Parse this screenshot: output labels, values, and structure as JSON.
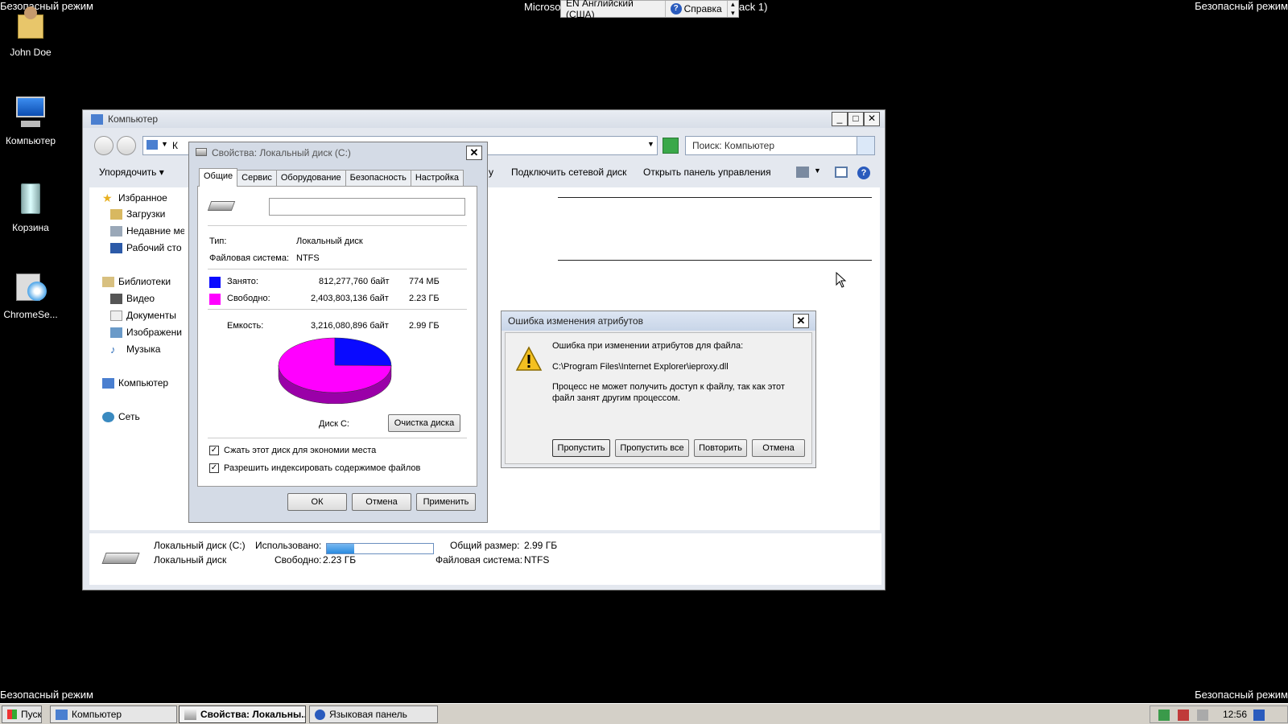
{
  "desktop": {
    "safe_mode": "Безопасный режим",
    "icons": [
      {
        "label": "John Doe",
        "icon": "user-folder-icon"
      },
      {
        "label": "Компьютер",
        "icon": "computer-icon"
      },
      {
        "label": "Корзина",
        "icon": "recycle-bin-icon"
      },
      {
        "label": "ChromeSe...",
        "icon": "setup-icon"
      }
    ],
    "top_title_left": "Microso",
    "top_title_right": "ack 1)"
  },
  "language_bar": {
    "language": "EN Английский (США)",
    "help": "Справка"
  },
  "explorer": {
    "title": "Компьютер",
    "address_fragment": "К",
    "search_placeholder": "Поиск: Компьютер",
    "toolbar": {
      "organize": "Упорядочить",
      "truncated": "у",
      "map_drive": "Подключить сетевой диск",
      "control_panel": "Открыть панель управления"
    },
    "nav": {
      "favorites": "Избранное",
      "downloads": "Загрузки",
      "recent": "Недавние ме",
      "desktop": "Рабочий сто",
      "libraries": "Библиотеки",
      "video": "Видео",
      "documents": "Документы",
      "pictures": "Изображени",
      "music": "Музыка",
      "computer": "Компьютер",
      "network": "Сеть"
    },
    "details": {
      "name": "Локальный диск (C:)",
      "type": "Локальный диск",
      "used_label": "Использовано:",
      "used_fraction": 0.26,
      "free_label": "Свободно:",
      "free_value": "2.23 ГБ",
      "total_label": "Общий размер:",
      "total_value": "2.99 ГБ",
      "fs_label": "Файловая система:",
      "fs_value": "NTFS"
    }
  },
  "properties": {
    "title": "Свойства: Локальный диск (C:)",
    "tabs": [
      "Общие",
      "Сервис",
      "Оборудование",
      "Безопасность",
      "Настройка"
    ],
    "type_label": "Тип:",
    "type_value": "Локальный диск",
    "fs_label": "Файловая система:",
    "fs_value": "NTFS",
    "used_label": "Занято:",
    "used_bytes": "812,277,760 байт",
    "used_size": "774 МБ",
    "free_label": "Свободно:",
    "free_bytes": "2,403,803,136 байт",
    "free_size": "2.23 ГБ",
    "capacity_label": "Емкость:",
    "capacity_bytes": "3,216,080,896 байт",
    "capacity_size": "2.99 ГБ",
    "used_fraction": 0.2526,
    "used_color": "#0a0aff",
    "free_color": "#ff00ff",
    "disk_label": "Диск C:",
    "cleanup": "Очистка диска",
    "compress": "Сжать этот диск для экономии места",
    "index": "Разрешить индексировать содержимое файлов",
    "ok": "ОК",
    "cancel": "Отмена",
    "apply": "Применить"
  },
  "error_dialog": {
    "title": "Ошибка изменения атрибутов",
    "line1": "Ошибка при изменении атрибутов для файла:",
    "path": "C:\\Program Files\\Internet Explorer\\ieproxy.dll",
    "line3": "Процесс не может получить доступ к файлу, так как этот",
    "line4": "файл занят другим процессом.",
    "skip": "Пропустить",
    "skip_all": "Пропустить все",
    "retry": "Повторить",
    "cancel": "Отмена"
  },
  "taskbar": {
    "start": "Пуск",
    "items": [
      "Компьютер",
      "Свойства: Локальны...",
      "Языковая панель"
    ],
    "clock": "12:56"
  }
}
